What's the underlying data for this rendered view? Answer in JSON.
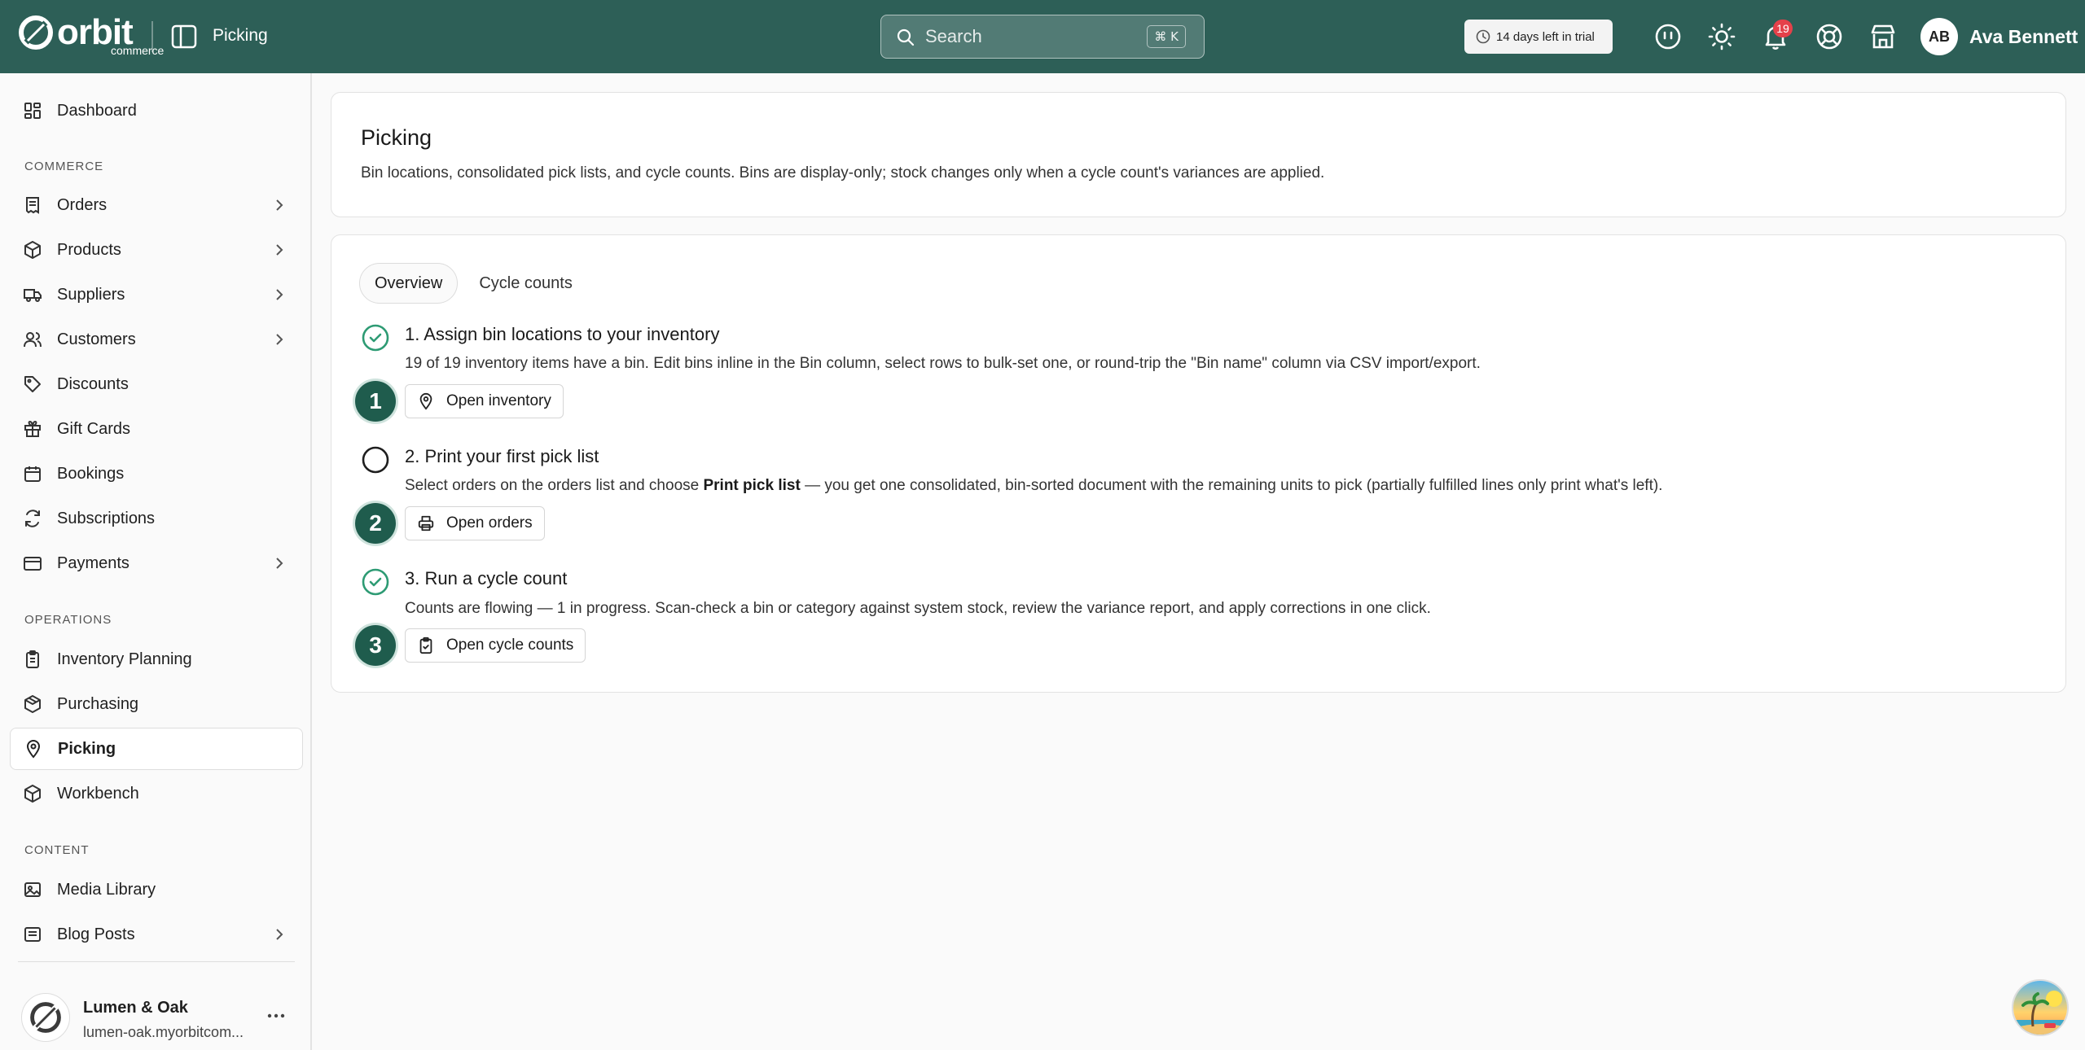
{
  "app": {
    "logo_text": "orbit",
    "logo_subtext": "commerce",
    "page": "Picking"
  },
  "topbar": {
    "search_placeholder": "Search",
    "search_shortcut": "⌘ K",
    "trial": "14 days left in trial",
    "notification_count": "19",
    "user_initials": "AB",
    "user_name": "Ava Bennett",
    "brand_color": "#2d5f57"
  },
  "sidebar": {
    "dashboard": "Dashboard",
    "section_commerce": "COMMERCE",
    "commerce": [
      {
        "label": "Orders",
        "icon": "receipt-icon",
        "chevron": true
      },
      {
        "label": "Products",
        "icon": "package-icon",
        "chevron": true
      },
      {
        "label": "Suppliers",
        "icon": "truck-icon",
        "chevron": true
      },
      {
        "label": "Customers",
        "icon": "users-icon",
        "chevron": true
      },
      {
        "label": "Discounts",
        "icon": "tag-icon",
        "chevron": false
      },
      {
        "label": "Gift Cards",
        "icon": "gift-icon",
        "chevron": false
      },
      {
        "label": "Bookings",
        "icon": "calendar-icon",
        "chevron": false
      },
      {
        "label": "Subscriptions",
        "icon": "refresh-icon",
        "chevron": false
      },
      {
        "label": "Payments",
        "icon": "wallet-icon",
        "chevron": true
      }
    ],
    "section_operations": "OPERATIONS",
    "operations": [
      {
        "label": "Inventory Planning",
        "icon": "clipboard-list-icon"
      },
      {
        "label": "Purchasing",
        "icon": "box-icon"
      },
      {
        "label": "Picking",
        "icon": "map-pin-icon"
      },
      {
        "label": "Workbench",
        "icon": "cube-icon"
      }
    ],
    "section_content": "CONTENT",
    "content": [
      {
        "label": "Media Library",
        "icon": "image-icon",
        "chevron": false
      },
      {
        "label": "Blog Posts",
        "icon": "newspaper-icon",
        "chevron": true
      }
    ],
    "store_name": "Lumen & Oak",
    "store_url": "lumen-oak.myorbitcom..."
  },
  "header_card": {
    "title": "Picking",
    "description": "Bin locations, consolidated pick lists, and cycle counts. Bins are display-only; stock changes only when a cycle count's variances are applied."
  },
  "tabs": [
    "Overview",
    "Cycle counts"
  ],
  "steps": [
    {
      "number": "1",
      "done": true,
      "title": "1. Assign bin locations to your inventory",
      "desc": "19 of 19 inventory items have a bin. Edit bins inline in the Bin column, select rows to bulk-set one, or round-trip the \"Bin name\" column via CSV import/export.",
      "button": "Open inventory"
    },
    {
      "number": "2",
      "done": false,
      "title": "2. Print your first pick list",
      "desc_before": "Select orders on the orders list and choose ",
      "desc_bold": "Print pick list",
      "desc_after": " — you get one consolidated, bin-sorted document with the remaining units to pick (partially fulfilled lines only print what's left).",
      "button": "Open orders"
    },
    {
      "number": "3",
      "done": true,
      "title": "3. Run a cycle count",
      "desc": "Counts are flowing — 1 in progress. Scan-check a bin or category against system stock, review the variance report, and apply corrections in one click.",
      "button": "Open cycle counts"
    }
  ]
}
